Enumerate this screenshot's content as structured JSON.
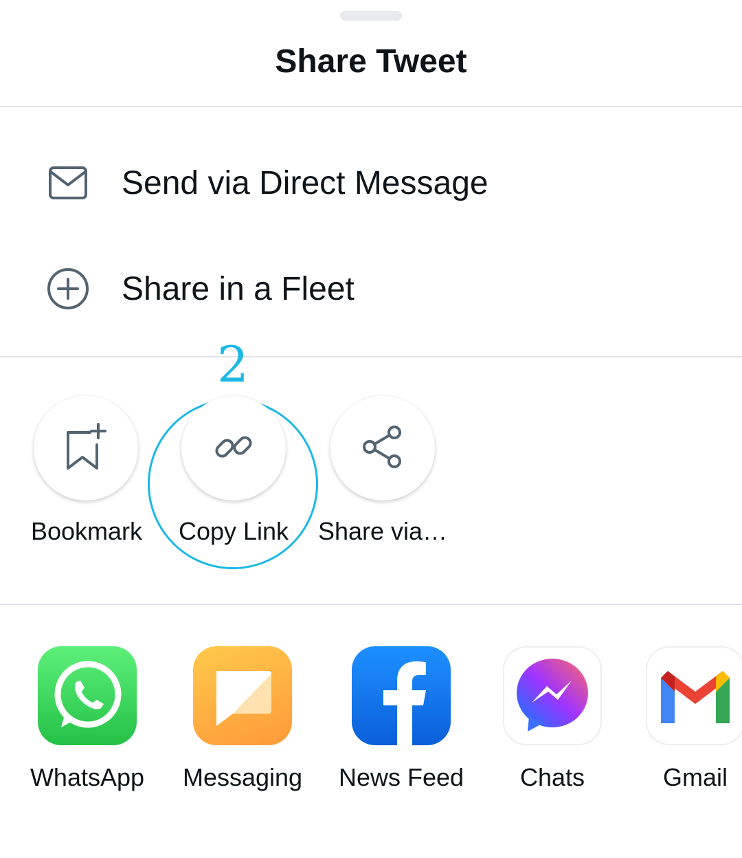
{
  "sheet": {
    "title": "Share Tweet"
  },
  "menu": {
    "direct_message": "Send via Direct Message",
    "fleet": "Share in a Fleet"
  },
  "actions": [
    {
      "label": "Bookmark",
      "icon": "bookmark-add-icon"
    },
    {
      "label": "Copy Link",
      "icon": "link-icon"
    },
    {
      "label": "Share via…",
      "icon": "share-icon"
    }
  ],
  "annotation": {
    "number": "2",
    "color": "#1bb8e6"
  },
  "apps": [
    {
      "label": "WhatsApp",
      "icon": "whatsapp-icon",
      "color": "#25d366"
    },
    {
      "label": "Messaging",
      "icon": "messaging-icon",
      "color": "#ffa53b"
    },
    {
      "label": "News Feed",
      "icon": "facebook-icon",
      "color": "#1877f2"
    },
    {
      "label": "Chats",
      "icon": "messenger-icon",
      "color": "#a033ff"
    },
    {
      "label": "Gmail",
      "icon": "gmail-icon",
      "color": "#ea4335"
    }
  ],
  "colors": {
    "icon_gray": "#536471",
    "divider": "#e1e4e8",
    "text": "#0f1419"
  }
}
